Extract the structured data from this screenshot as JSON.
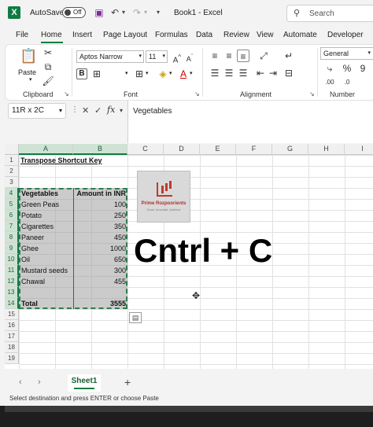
{
  "titlebar": {
    "autosave_label": "AutoSave",
    "autosave_state": "Off",
    "doc_title": "Book1 - Excel",
    "search_placeholder": "Search"
  },
  "menu": [
    "File",
    "Home",
    "Insert",
    "Page Layout",
    "Formulas",
    "Data",
    "Review",
    "View",
    "Automate",
    "Developer"
  ],
  "ribbon": {
    "paste_label": "Paste",
    "font_name": "Aptos Narrow",
    "font_size": "11",
    "number_format": "General",
    "groups": [
      "Clipboard",
      "Font",
      "Alignment",
      "Number"
    ]
  },
  "formula_bar": {
    "name_box": "11R x 2C",
    "formula": "Vegetables"
  },
  "grid": {
    "columns": [
      "A",
      "B",
      "C",
      "D",
      "E",
      "F",
      "G",
      "H",
      "I"
    ],
    "rows": [
      "1",
      "2",
      "3",
      "4",
      "5",
      "6",
      "7",
      "8",
      "9",
      "10",
      "11",
      "12",
      "13",
      "14",
      "15",
      "16",
      "17",
      "18",
      "19"
    ],
    "title": "Transpose Shortcut Key",
    "header": [
      "Vegetables",
      "Amount in INR"
    ],
    "data": [
      [
        "Green Peas",
        "100"
      ],
      [
        "Potato",
        "250"
      ],
      [
        "Cigarettes",
        "350"
      ],
      [
        "Paneer",
        "450"
      ],
      [
        "Ghee",
        "1000"
      ],
      [
        "Oil",
        "650"
      ],
      [
        "Mustard seeds",
        "300"
      ],
      [
        "Chawal",
        "455"
      ]
    ],
    "total_label": "Total",
    "total_value": "3555"
  },
  "overlay": {
    "logo_name": "Prime Rozpoorients",
    "logo_tagline": "Grow. Innovate. Achieve",
    "big_text": "Cntrl + C"
  },
  "sheets": {
    "active": "Sheet1",
    "add": "+"
  },
  "status": {
    "message": "Select destination and press ENTER or choose Paste"
  },
  "colors": {
    "excel_green": "#107c41",
    "selection_border": "#2e7d4f"
  }
}
